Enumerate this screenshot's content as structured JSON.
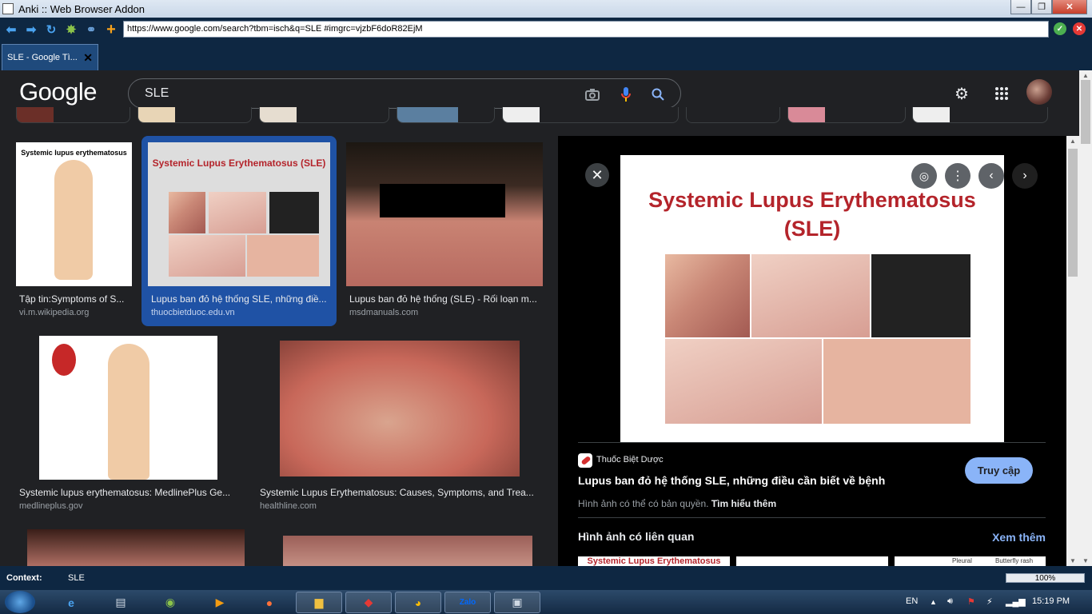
{
  "window": {
    "title": "Anki :: Web Browser Addon",
    "min": "—",
    "max": "❐",
    "close": "✕"
  },
  "toolbar": {
    "url": "https://www.google.com/search?tbm=isch&q=SLE #imgrc=vjzbF6doR82EjM"
  },
  "tab": {
    "label": "SLE - Google Tì...",
    "close": "✕"
  },
  "google": {
    "logo": "Google",
    "query": "SLE"
  },
  "results": [
    {
      "title": "Tập tin:Symptoms of S...",
      "source": "vi.m.wikipedia.org",
      "thumb_heading": "Systemic lupus erythematosus"
    },
    {
      "title": "Lupus ban đỏ hệ thống SLE, những điề...",
      "source": "thuocbietduoc.edu.vn",
      "thumb_heading": "Systemic Lupus Erythematosus (SLE)"
    },
    {
      "title": "Lupus ban đỏ hệ thống (SLE) - Rối loạn m...",
      "source": "msdmanuals.com"
    },
    {
      "title": "Systemic lupus erythematosus: MedlinePlus Ge...",
      "source": "medlineplus.gov"
    },
    {
      "title": "Systemic Lupus Erythematosus: Causes, Symptoms, and Trea...",
      "source": "healthline.com"
    }
  ],
  "panel": {
    "image_title": "Systemic Lupus Erythematosus (SLE)",
    "site_name": "Thuốc Biệt Dược",
    "headline": "Lupus ban đỏ hệ thống SLE, những điều cần biết về bệnh",
    "visit_label": "Truy cập",
    "copyright": "Hình ảnh có thể có bản quyền.",
    "learn_more": "Tìm hiểu thêm",
    "related_title": "Hình ảnh có liên quan",
    "see_more": "Xem thêm",
    "related_thumb_heading": "Systemic Lupus Erythematosus",
    "related_thumb_labels": [
      "Pleural",
      "Butterfly rash"
    ]
  },
  "context": {
    "label": "Context:",
    "value": "SLE",
    "zoom": "100%"
  },
  "taskbar": {
    "lang": "EN",
    "time": "15:19 PM"
  },
  "colors": {
    "accent": "#1f52a5",
    "link": "#8ab4f8",
    "button": "#8ab4f8",
    "header_bg": "#202124"
  }
}
